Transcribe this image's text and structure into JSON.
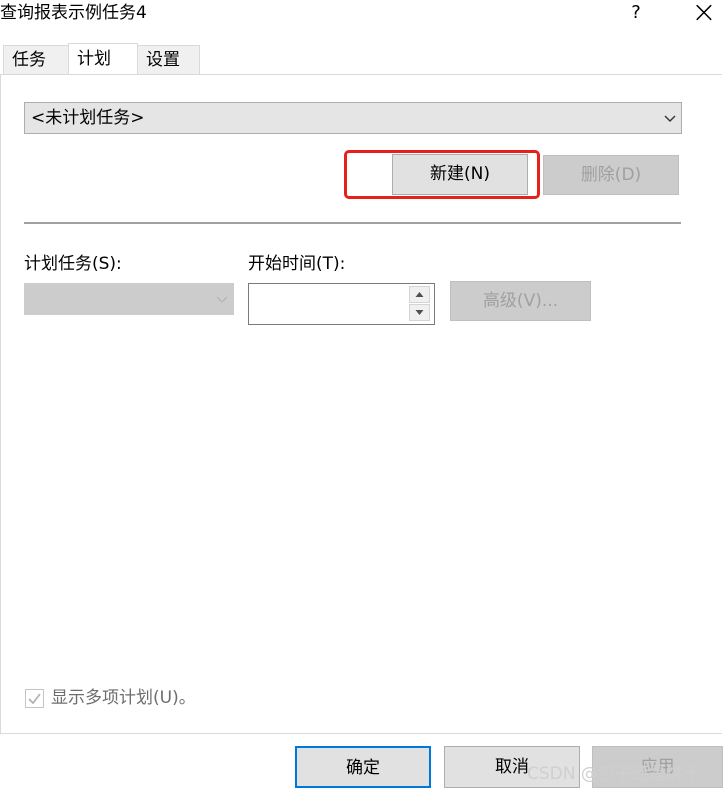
{
  "window": {
    "title": "查询报表示例任务4",
    "help_glyph": "?",
    "close_glyph": "×"
  },
  "tabs": [
    {
      "label": "任务",
      "active": false
    },
    {
      "label": "计划",
      "active": true
    },
    {
      "label": "设置",
      "active": false
    }
  ],
  "schedule": {
    "selected": "<未计划任务>"
  },
  "buttons": {
    "new_label": "新建(N)",
    "delete_label": "删除(D)",
    "advanced_label": "高级(V)...",
    "ok_label": "确定",
    "cancel_label": "取消",
    "apply_label": "应用"
  },
  "fields": {
    "schedule_task_label": "计划任务(S):",
    "start_time_label": "开始时间(T):",
    "start_time_value": ""
  },
  "options": {
    "show_multiple_label": "显示多项计划(U)。",
    "show_multiple_checked": true
  },
  "watermark": "CSDN @包子还是饼干",
  "colors": {
    "highlight": "#e8201b",
    "disabled": "#cccccc",
    "accent": "#0078d7"
  }
}
